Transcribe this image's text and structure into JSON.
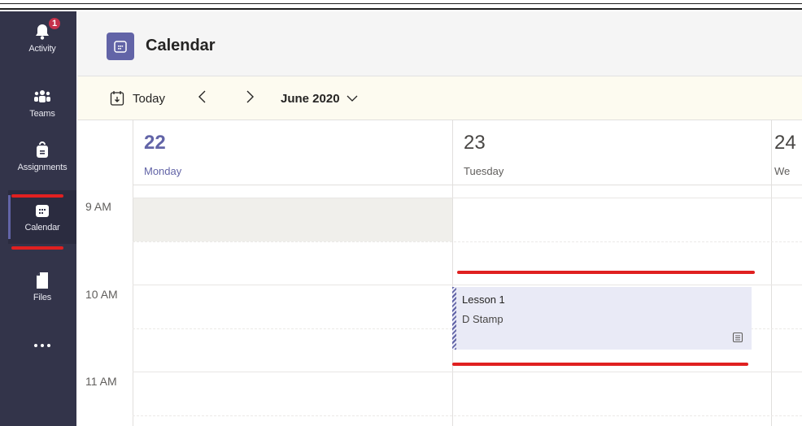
{
  "rail": {
    "items": [
      {
        "label": "Activity",
        "icon": "bell-icon",
        "badge": "1"
      },
      {
        "label": "Teams",
        "icon": "teams-icon"
      },
      {
        "label": "Assignments",
        "icon": "assignments-icon"
      },
      {
        "label": "Calendar",
        "icon": "calendar-icon"
      },
      {
        "label": "Files",
        "icon": "file-icon"
      },
      {
        "label": "",
        "icon": "more-icon"
      }
    ]
  },
  "header": {
    "title": "Calendar"
  },
  "toolbar": {
    "today_label": "Today",
    "month_label": "June 2020"
  },
  "days": [
    {
      "num": "22",
      "name": "Monday"
    },
    {
      "num": "23",
      "name": "Tuesday"
    },
    {
      "num": "24",
      "name": "We"
    }
  ],
  "times": [
    "9 AM",
    "10 AM",
    "11 AM"
  ],
  "event": {
    "title": "Lesson 1",
    "organizer": "D Stamp"
  },
  "colors": {
    "rail": "#33344a",
    "accent": "#6264a7",
    "badge": "#c4314b",
    "annotation": "#e02020",
    "event_bg": "#e9eaf6"
  }
}
